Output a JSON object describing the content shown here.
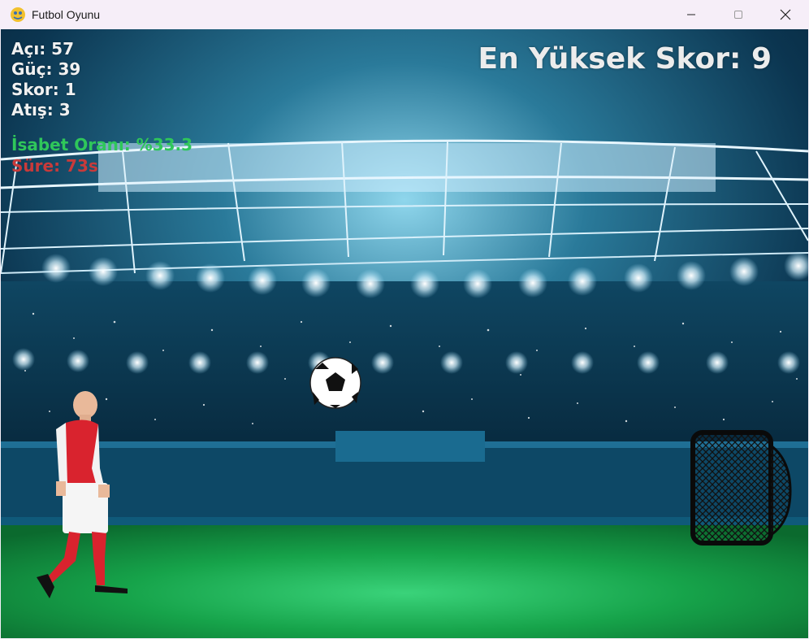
{
  "window": {
    "title": "Futbol Oyunu"
  },
  "hud": {
    "angle": "Açı: 57",
    "power": "Güç: 39",
    "score": "Skor: 1",
    "shots": "Atış: 3",
    "accuracy": "İsabet Oranı: %33.3",
    "time": "Süre: 73s",
    "high_score": "En Yüksek Skor: 9"
  },
  "colors": {
    "accuracy": "#2fc75a",
    "time": "#c83a3a",
    "hud_text": "#f1f1f1",
    "pitch": "#17a24a",
    "jersey": "#d9232e"
  },
  "icons": {
    "app": "pygame-snake-icon",
    "minimize": "minimize-icon",
    "maximize": "maximize-icon",
    "close": "close-icon"
  }
}
